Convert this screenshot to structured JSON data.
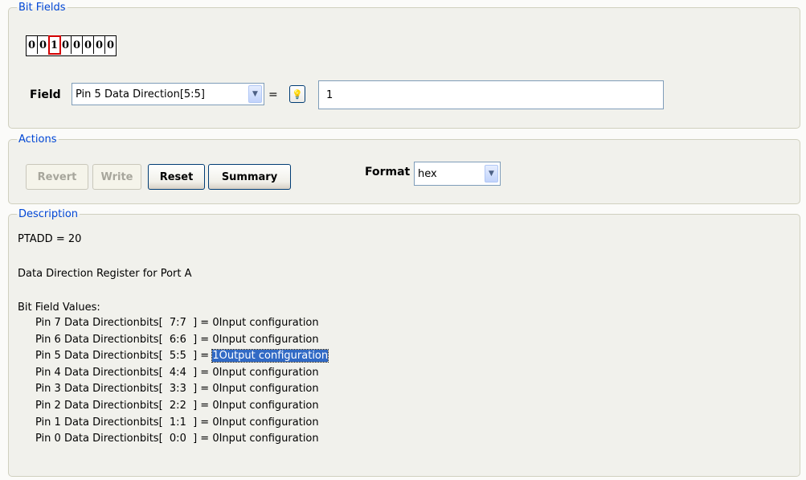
{
  "bit_fields": {
    "legend": "Bit Fields",
    "bits": [
      "0",
      "0",
      "1",
      "0",
      "0",
      "0",
      "0",
      "0"
    ],
    "selected_index": 2,
    "field_label": "Field",
    "field_select": "Pin 5 Data Direction[5:5]",
    "equals": "=",
    "value": "1"
  },
  "actions": {
    "legend": "Actions",
    "revert": "Revert",
    "write": "Write",
    "reset": "Reset",
    "summary": "Summary",
    "format_label": "Format",
    "format_value": "hex"
  },
  "description": {
    "legend": "Description",
    "register": "PTADD = 20",
    "title": "Data Direction Register for Port A",
    "values_header": "Bit Field Values:",
    "rows": [
      {
        "name": "Pin 7 Data Directionbits[  7:7  ] = ",
        "value": "0Input configuration"
      },
      {
        "name": "Pin 6 Data Directionbits[  6:6  ] = ",
        "value": "0Input configuration"
      },
      {
        "name": "Pin 5 Data Directionbits[  5:5  ] = ",
        "value": "1Output configuration"
      },
      {
        "name": "Pin 4 Data Directionbits[  4:4  ] = ",
        "value": "0Input configuration"
      },
      {
        "name": "Pin 3 Data Directionbits[  3:3  ] = ",
        "value": "0Input configuration"
      },
      {
        "name": "Pin 2 Data Directionbits[  2:2  ] = ",
        "value": "0Input configuration"
      },
      {
        "name": "Pin 1 Data Directionbits[  1:1  ] = ",
        "value": "0Input configuration"
      },
      {
        "name": "Pin 0 Data Directionbits[  0:0  ] = ",
        "value": "0Input configuration"
      }
    ],
    "highlighted_row": 2
  }
}
